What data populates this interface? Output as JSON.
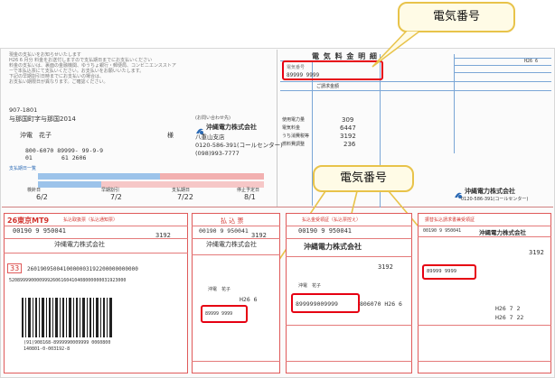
{
  "callouts": {
    "top": "電気番号",
    "middle": "電気番号"
  },
  "left_top": {
    "notice_lines": [
      "現金の支払いをお知らせいたします",
      "H26  6  月分 料金をお送付しますので支払期日までにお支払いください",
      "料金の支払いは、裏面の金融機関、ゆうちょ銀行・郵便局、コンビニエンスストア",
      "ーで本払込票にて支払いください。お支払いをお願いいたします。",
      "下記の早期割引日時までにお支払いの場合は、",
      "お支払い期限日が異なります。ご確認ください。"
    ],
    "postal": "907-1801",
    "address": "与那国町字与那国2014",
    "name": "沖電　花子",
    "honorific": "様",
    "company_label": "(お問い合わせ先)",
    "company": "沖縄電力株式会社",
    "branch": "八重山支店",
    "phone1": "0120-586-391(コールセンター)",
    "phone2": "(098)993-7777",
    "acct_row1": "800-6070   89999-   99-9-9",
    "acct_row2": "61        2606",
    "acct_row0": "01",
    "schedule_title": "支払期日一覧",
    "dates": [
      "6/2",
      "7/2",
      "7/22",
      "8/1"
    ],
    "date_labels": [
      "検針日",
      "早期割引",
      "支払期日",
      "停止予定日"
    ]
  },
  "right_top": {
    "title": "電 気 料 金 明 細",
    "number_label": "電気番号",
    "number_value": "89999  9999",
    "month_label": "H26 6",
    "amount_label": "ご請求金額",
    "rows": [
      {
        "label": "使用電力量",
        "value": "309"
      },
      {
        "label": "電気料金",
        "value": "6447"
      },
      {
        "label": "うち消費税等",
        "value": "3192"
      },
      {
        "label": "燃料費調整",
        "value": "236"
      }
    ],
    "company": "沖縄電力株式会社",
    "phone": "0120-586-391(コールセンター)"
  },
  "slips": {
    "slip1": {
      "header": "26東京MT9",
      "title": "払込取扱票（払込通知票）",
      "account": "00190 9 950041",
      "amount": "3192",
      "company": "沖縄電力株式会社"
    },
    "slip2": {
      "title": "払 込 票",
      "account": "00190 9 950041",
      "amount": "3192",
      "company": "沖縄電力株式会社",
      "name": "沖電　花子",
      "month": "H26 6",
      "number": "89999  9999"
    },
    "slip3": {
      "title": "払込金受領証（払込票控え）",
      "account": "00190 9 950041",
      "amount": "3192",
      "company": "沖縄電力株式会社",
      "name": "沖電　花子",
      "number": "899999009999",
      "tail": "806070 H26 6"
    },
    "slip4": {
      "title": "振替払込請求書兼受領証",
      "account": "00190 9 950041",
      "company": "沖縄電力株式会社",
      "number": "89999 9999",
      "amount": "3192",
      "date1": "H26 7 2",
      "date2": "H26 7 22"
    }
  },
  "barcode": {
    "ocr1": "2601909500410000003192200000000000",
    "ocr2": "5208999900009992606160410408000000031923000",
    "label1": "(91)908168-8999990009999 0060800",
    "label2": "140801-0-003192-8",
    "page": "33"
  }
}
